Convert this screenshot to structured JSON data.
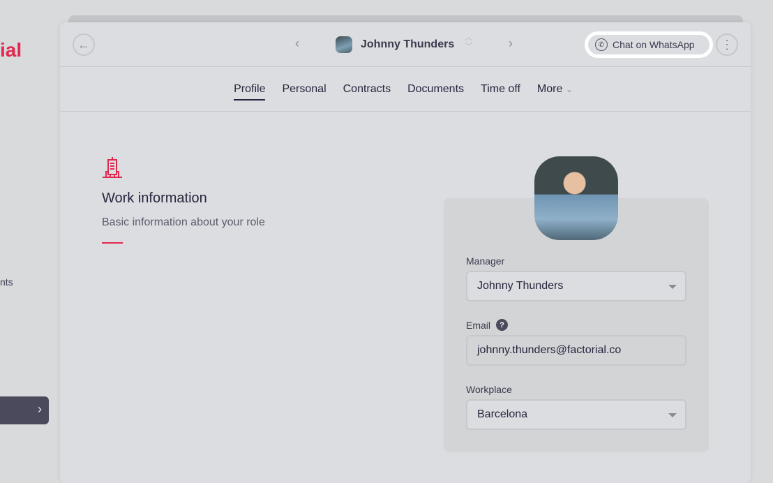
{
  "sidebar": {
    "logo": "ial",
    "item": "nts",
    "collapse_icon": "chevron-right-icon"
  },
  "header": {
    "employee_name": "Johnny Thunders",
    "whatsapp_label": "Chat on WhatsApp"
  },
  "tabs": [
    {
      "label": "Profile",
      "active": true
    },
    {
      "label": "Personal"
    },
    {
      "label": "Contracts"
    },
    {
      "label": "Documents"
    },
    {
      "label": "Time off"
    },
    {
      "label": "More"
    }
  ],
  "work": {
    "title": "Work information",
    "subtitle": "Basic information about your role",
    "accent": "#e0294f"
  },
  "form": {
    "manager": {
      "label": "Manager",
      "value": "Johnny Thunders"
    },
    "email": {
      "label": "Email",
      "value": "johnny.thunders@factorial.co"
    },
    "workplace": {
      "label": "Workplace",
      "value": "Barcelona"
    }
  }
}
